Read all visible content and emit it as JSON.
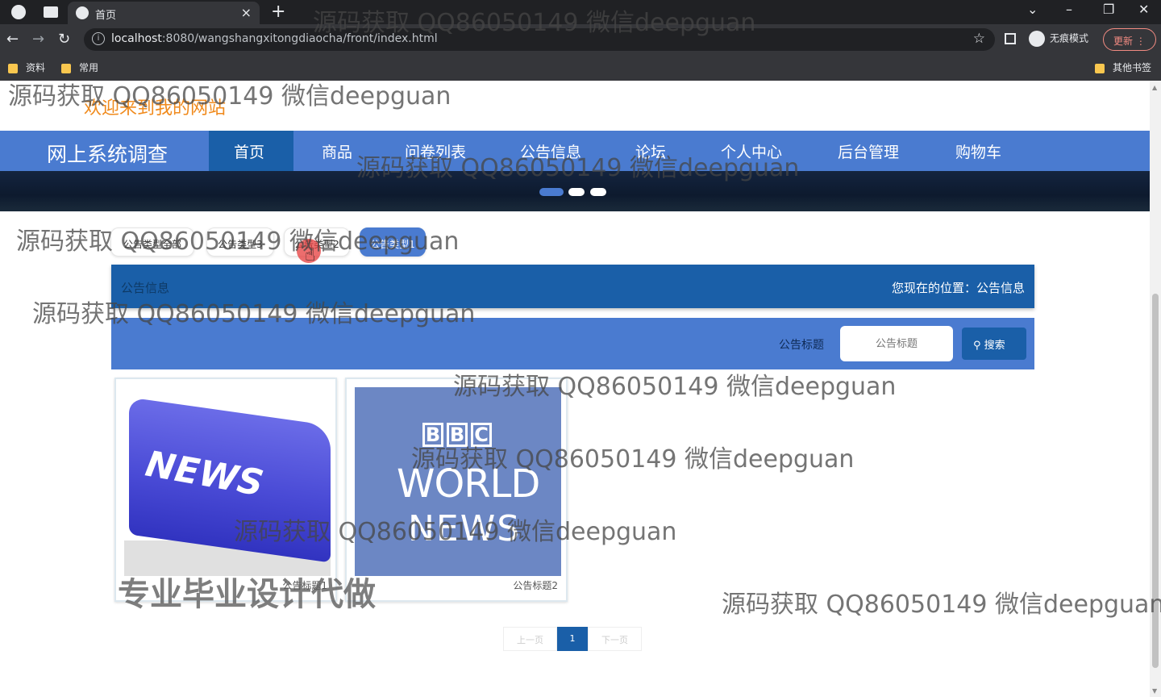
{
  "browser": {
    "tab_title": "首页",
    "url_host": "localhost",
    "url_rest": ":8080/wangshangxitongdiaocha/front/index.html",
    "incognito_label": "无痕模式",
    "update_label": "更新",
    "bookmarks": [
      "资料",
      "常用"
    ],
    "other_bookmarks": "其他书签",
    "info_icon": "i"
  },
  "site": {
    "welcome": "欢迎来到我的网站",
    "brand": "网上系统调查",
    "nav": [
      "首页",
      "商品",
      "问卷列表",
      "公告信息",
      "论坛",
      "个人中心",
      "后台管理",
      "购物车"
    ]
  },
  "filters": [
    "公告类型全部",
    "公告类型3",
    "公告类型2",
    "公告类型1"
  ],
  "infobar": {
    "title": "公告信息",
    "location": "您现在的位置：公告信息"
  },
  "search": {
    "label": "公告标题",
    "placeholder": "公告标题",
    "button": "搜索"
  },
  "cards": [
    {
      "caption": "公告标题1",
      "image_text": "NEWS"
    },
    {
      "caption": "公告标题2",
      "image_text_1": "WORLD",
      "image_text_2": "NEWS",
      "bbc": [
        "B",
        "B",
        "C"
      ]
    }
  ],
  "pager": {
    "prev": "上一页",
    "current": "1",
    "next": "下一页"
  },
  "watermarks": {
    "main": "源码获取 QQ86050149 微信deepguan",
    "promo": "专业毕业设计代做"
  },
  "colors": {
    "nav": "#4a7bd0",
    "nav_active": "#1a5fa8",
    "welcome": "#f08a1c"
  }
}
